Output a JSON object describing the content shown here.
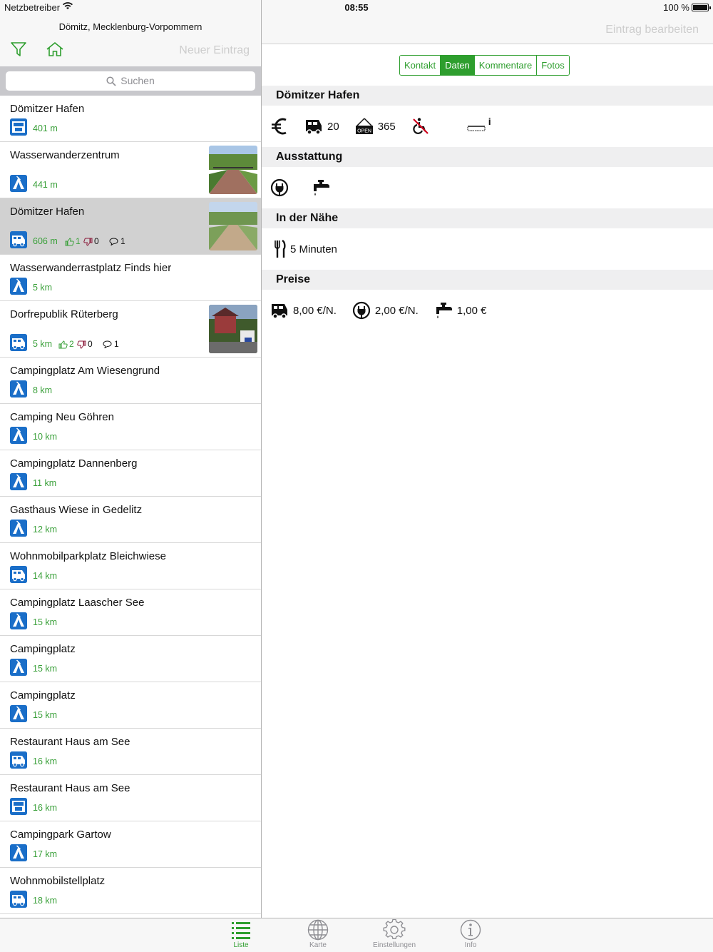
{
  "status_bar": {
    "carrier": "Netzbetreiber",
    "time": "08:55",
    "battery": "100 %"
  },
  "left_header": {
    "location": "Dömitz, Mecklenburg-Vorpommern",
    "new_entry": "Neuer Eintrag"
  },
  "search": {
    "placeholder": "Suchen"
  },
  "entries": [
    {
      "title": "Dömitzer Hafen",
      "type": "service",
      "distance": "401 m"
    },
    {
      "title": "Wasserwanderzentrum",
      "type": "camping",
      "distance": "441 m",
      "thumb": true
    },
    {
      "title": "Dömitzer Hafen",
      "type": "motorhome",
      "distance": "606 m",
      "likes": "1",
      "dislikes": "0",
      "comments": "1",
      "thumb": true,
      "selected": true
    },
    {
      "title": "Wasserwanderrastplatz Finds hier",
      "type": "camping",
      "distance": "5 km"
    },
    {
      "title": "Dorfrepublik Rüterberg",
      "type": "motorhome",
      "distance": "5 km",
      "likes": "2",
      "dislikes": "0",
      "comments": "1",
      "thumb": true
    },
    {
      "title": "Campingplatz Am Wiesengrund",
      "type": "camping",
      "distance": "8 km"
    },
    {
      "title": "Camping Neu Göhren",
      "type": "camping",
      "distance": "10 km"
    },
    {
      "title": "Campingplatz Dannenberg",
      "type": "camping",
      "distance": "11 km"
    },
    {
      "title": "Gasthaus Wiese in Gedelitz",
      "type": "camping",
      "distance": "12 km"
    },
    {
      "title": "Wohnmobilparkplatz Bleichwiese",
      "type": "motorhome",
      "distance": "14 km"
    },
    {
      "title": "Campingplatz Laascher See",
      "type": "camping",
      "distance": "15 km"
    },
    {
      "title": "Campingplatz",
      "type": "camping",
      "distance": "15 km"
    },
    {
      "title": "Campingplatz",
      "type": "camping",
      "distance": "15 km"
    },
    {
      "title": "Restaurant Haus am See",
      "type": "motorhome",
      "distance": "16 km"
    },
    {
      "title": "Restaurant Haus am See",
      "type": "service",
      "distance": "16 km"
    },
    {
      "title": "Campingpark Gartow",
      "type": "camping",
      "distance": "17 km"
    },
    {
      "title": "Wohnmobilstellplatz",
      "type": "motorhome",
      "distance": "18 km"
    }
  ],
  "detail": {
    "edit_label": "Eintrag bearbeiten",
    "segments": [
      "Kontakt",
      "Daten",
      "Kommentare",
      "Fotos"
    ],
    "active_segment": "Daten",
    "title": "Dömitzer Hafen",
    "summary": {
      "spaces": "20",
      "open_days": "365",
      "open_sign": "OPEN",
      "info_mark": "i"
    },
    "equipment_heading": "Ausstattung",
    "nearby_heading": "In der Nähe",
    "nearby_restaurant": "5 Minuten",
    "prices_heading": "Preise",
    "prices": {
      "overnight": "8,00 €/N.",
      "electricity": "2,00 €/N.",
      "water": "1,00 €"
    }
  },
  "tabs": [
    {
      "label": "Liste",
      "icon": "list-icon",
      "active": true
    },
    {
      "label": "Karte",
      "icon": "globe-icon"
    },
    {
      "label": "Einstellungen",
      "icon": "gear-icon"
    },
    {
      "label": "Info",
      "icon": "info-icon"
    }
  ],
  "colors": {
    "accent": "#2e9e2e",
    "type_icon_blue": "#1a6ec8",
    "dislike": "#8b1a3a",
    "header_bg": "#f7f7f7"
  }
}
